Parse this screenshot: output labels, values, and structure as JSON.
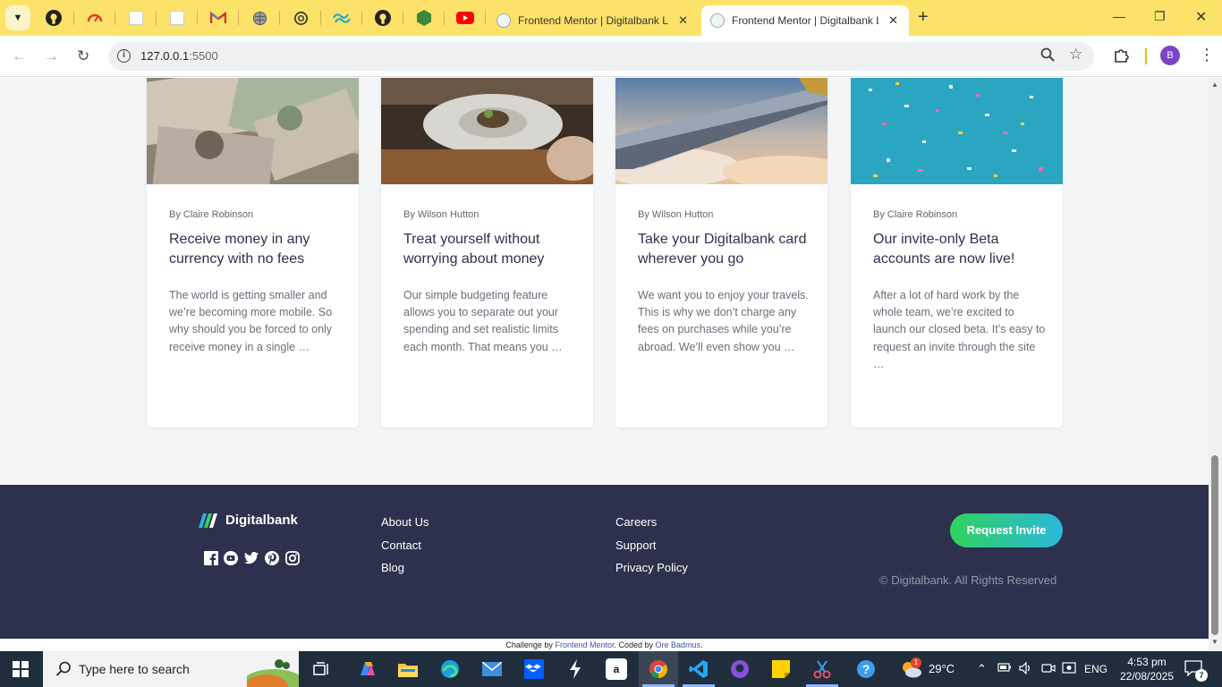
{
  "browser": {
    "tabs": [
      {
        "title": "Frontend Mentor | Digitalbank L",
        "active": false
      },
      {
        "title": "Frontend Mentor | Digitalbank L",
        "active": true
      }
    ],
    "url_host": "127.0.0.1",
    "url_port": ":5500",
    "profile_initial": "B"
  },
  "cards": [
    {
      "author": "By Claire Robinson",
      "title": "Receive money in any currency with no fees",
      "body": "The world is getting smaller and we’re becoming more mobile. So why should you be forced to only receive money in a single …"
    },
    {
      "author": "By Wilson Hutton",
      "title": "Treat yourself without worrying about money",
      "body": "Our simple budgeting feature allows you to separate out your spending and set realistic limits each month. That means you …"
    },
    {
      "author": "By Wilson Hutton",
      "title": "Take your Digitalbank card wherever you go",
      "body": "We want you to enjoy your travels. This is why we don’t charge any fees on purchases while you’re abroad. We’ll even show you …"
    },
    {
      "author": "By Claire Robinson",
      "title": "Our invite-only Beta accounts are now live!",
      "body": "After a lot of hard work by the whole team, we’re excited to launch our closed beta. It’s easy to request an invite through the site …"
    }
  ],
  "footer": {
    "logo_text": "Digitalbank",
    "links_col1": [
      "About Us",
      "Contact",
      "Blog"
    ],
    "links_col2": [
      "Careers",
      "Support",
      "Privacy Policy"
    ],
    "cta": "Request Invite",
    "copyright": "© Digitalbank. All Rights Reserved",
    "social_icons": [
      "facebook-icon",
      "youtube-icon",
      "twitter-icon",
      "pinterest-icon",
      "instagram-icon"
    ]
  },
  "attribution": {
    "prefix": "Challenge by",
    "challenge_link": "Frontend Mentor",
    "middle": ". Coded by",
    "author_link": "Ore Badmus",
    "suffix": "."
  },
  "taskbar": {
    "search_placeholder": "Type here to search",
    "weather_temp": "29°C",
    "language": "ENG",
    "time": "4:53 pm",
    "date": "22/08/2025",
    "notification_count": "7",
    "weather_badge": "1"
  },
  "colors": {
    "tabbar": "#fde26a",
    "footer": "#2d314d",
    "cta_start": "#31d35c",
    "cta_end": "#2bb7da",
    "taskbar": "#1f2d3d"
  }
}
